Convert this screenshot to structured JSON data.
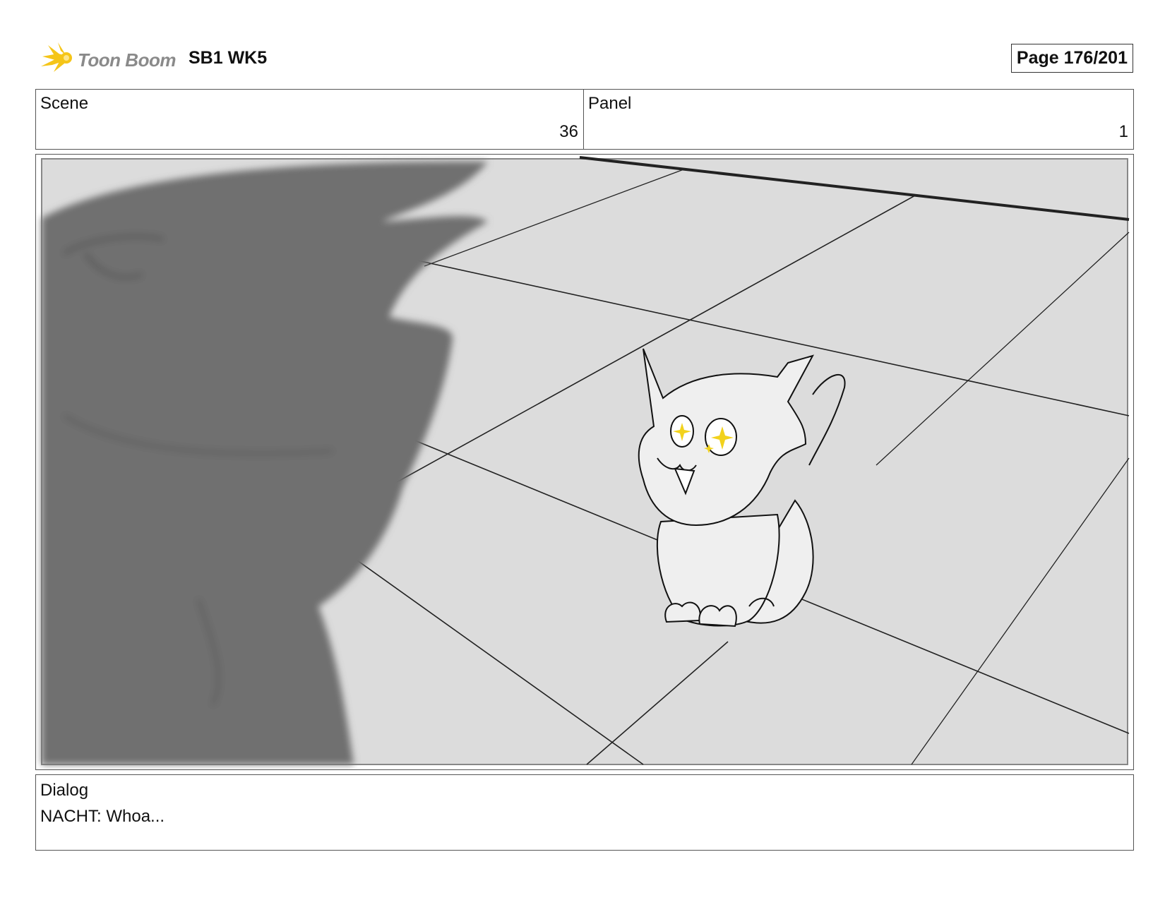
{
  "header": {
    "logo_text": "Toon Boom",
    "project_title": "SB1 WK5",
    "page_label": "Page 176/201"
  },
  "info": {
    "scene_label": "Scene",
    "scene_value": "36",
    "panel_label": "Panel",
    "panel_value": "1"
  },
  "dialog": {
    "label": "Dialog",
    "text": "NACHT: Whoa..."
  },
  "colors": {
    "logo_accent": "#f5c518",
    "eye_sparkle": "#f2d21c",
    "floor": "#dcdcdc",
    "foreground_figure": "#6f6f6f"
  }
}
